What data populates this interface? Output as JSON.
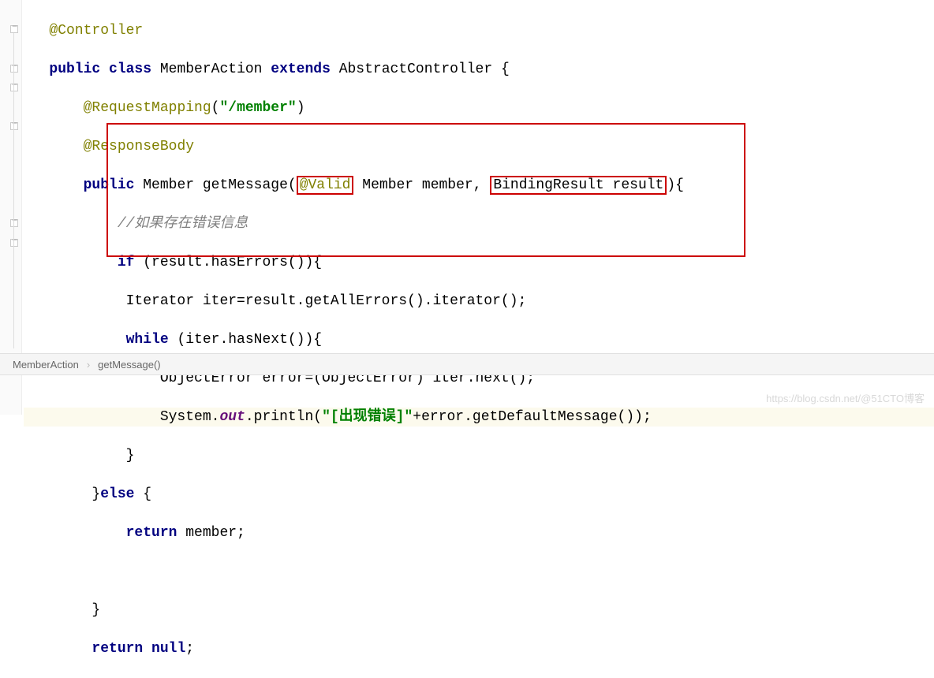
{
  "code": {
    "controller_annotation": "@Controller",
    "public_kw": "public",
    "class_kw": "class",
    "class_name": " MemberAction ",
    "extends_kw": "extends",
    "parent_class": " AbstractController {",
    "request_mapping": "@RequestMapping",
    "request_mapping_path": "\"/member\"",
    "response_body": "@ResponseBody",
    "method_public": "public",
    "method_return": " Member getMessage(",
    "valid_annotation": "@Valid",
    "method_params1": " Member member, ",
    "binding_result": "BindingResult result",
    "method_params_close": "){",
    "comment_text": "//如果存在错误信息",
    "if_kw": "if",
    "if_cond": " (result.hasErrors()){",
    "iterator_line": "            Iterator iter=result.getAllErrors().iterator();",
    "while_kw": "while",
    "while_cond": " (iter.hasNext()){",
    "obj_error_line": "                ObjectError error=(ObjectError) iter.next();",
    "system": "                System.",
    "out_field": "out",
    "println": ".println(",
    "println_str": "\"[出现错误]\"",
    "println_end": "+error.getDefaultMessage());",
    "brace_close1": "            }",
    "else_line_open": "        }",
    "else_kw": "else",
    "else_brace": " {",
    "return_kw": "return",
    "return_val": " member;",
    "brace_close2": "        }",
    "return_null_kw": "return",
    "return_null_val": " ",
    "null_kw": "null",
    "semicolon": ";"
  },
  "breadcrumb": {
    "item1": "MemberAction",
    "item2": "getMessage()"
  },
  "watermark": "https://blog.csdn.net/@51CTO博客"
}
